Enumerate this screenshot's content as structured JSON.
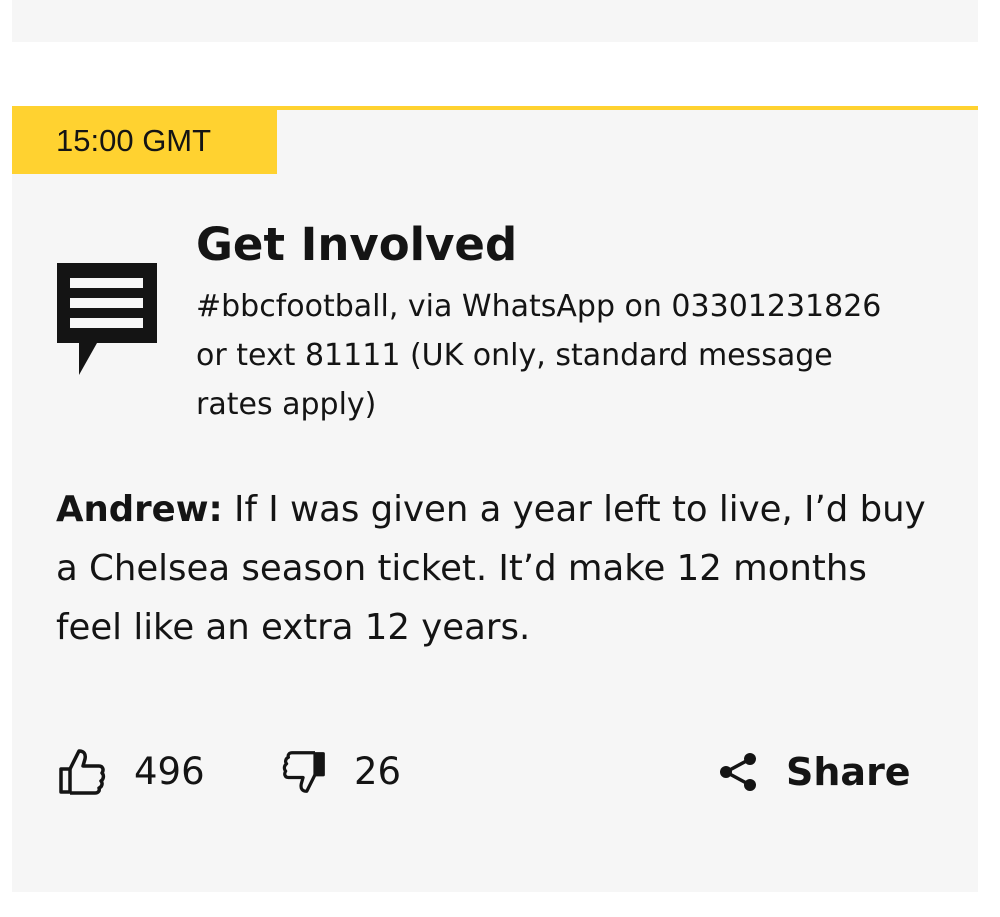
{
  "post": {
    "timestamp": "15:00 GMT",
    "get_involved": {
      "title": "Get Involved",
      "text": "#bbcfootball, via WhatsApp on 03301231826 or text 81111 (UK only, standard message rates apply)",
      "icon": "speech-bubble-icon"
    },
    "comment": {
      "author": "Andrew:",
      "body": " If I was given a year left to live, I’d buy a Chelsea season ticket. It’d make 12 months feel like an extra 12 years."
    },
    "actions": {
      "like_count": "496",
      "dislike_count": "26",
      "share_label": "Share",
      "like_icon": "thumbs-up-icon",
      "dislike_icon": "thumbs-down-icon",
      "share_icon": "share-icon"
    }
  },
  "colors": {
    "accent": "#ffd230",
    "card_background": "#f6f6f6",
    "text": "#141414"
  }
}
